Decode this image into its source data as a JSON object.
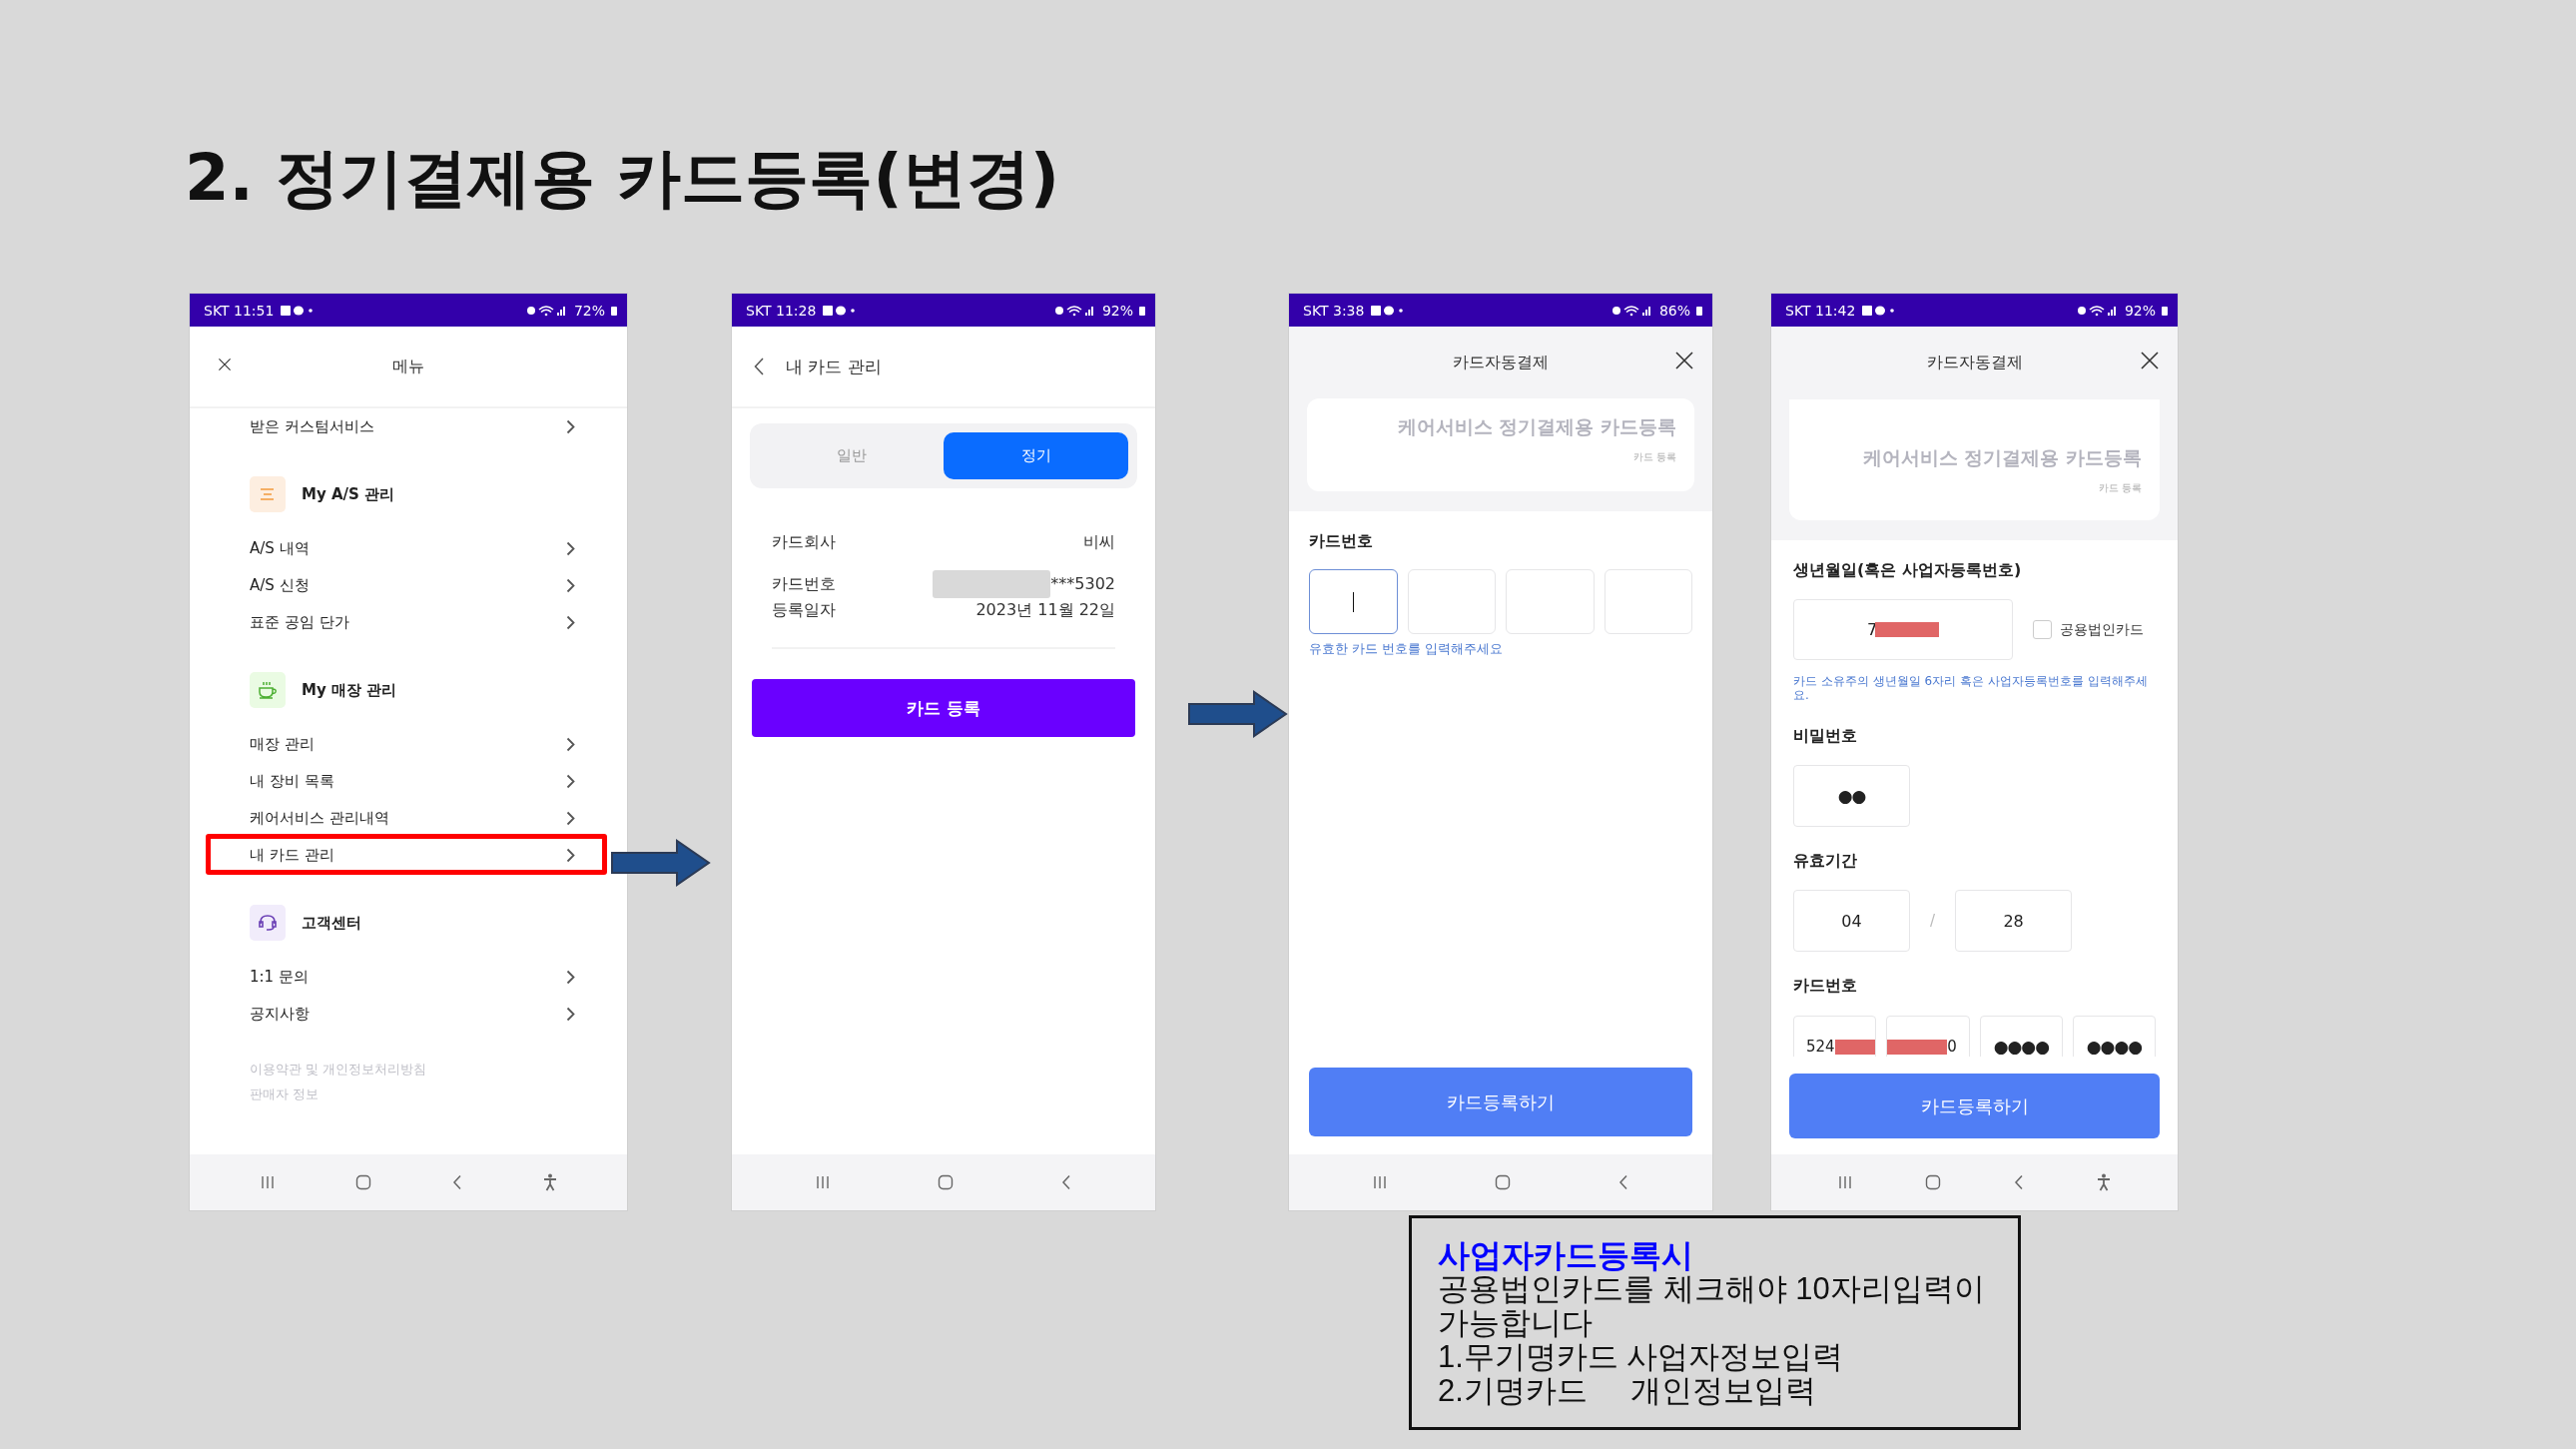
{
  "title": "2. 정기결제용 카드등록(변경)",
  "phones": [
    {
      "kind": "menu",
      "status": {
        "time": "SKT 11:51",
        "battery": "72%"
      },
      "header": {
        "title": "메뉴"
      },
      "items": [
        {
          "kind": "link",
          "label": "받은 커스텀서비스",
          "highlighted": false
        },
        {
          "kind": "section",
          "label": "My A/S 관리"
        },
        {
          "kind": "link",
          "label": "A/S 내역",
          "highlighted": false
        },
        {
          "kind": "link",
          "label": "A/S 신청",
          "highlighted": false
        },
        {
          "kind": "link",
          "label": "표준 공임 단가",
          "highlighted": false
        },
        {
          "kind": "section",
          "label": "My 매장 관리"
        },
        {
          "kind": "link",
          "label": "매장 관리",
          "highlighted": false
        },
        {
          "kind": "link",
          "label": "내 장비 목록",
          "highlighted": false
        },
        {
          "kind": "link",
          "label": "케어서비스 관리내역",
          "highlighted": false
        },
        {
          "kind": "link",
          "label": "내 카드 관리",
          "highlighted": true
        },
        {
          "kind": "section",
          "label": "고객센터"
        },
        {
          "kind": "link",
          "label": "1:1 문의",
          "highlighted": false
        },
        {
          "kind": "link",
          "label": "공지사항",
          "highlighted": false
        }
      ],
      "footer_links": [
        "이용약관 및 개인정보처리방침",
        "판매자 정보"
      ],
      "nav": {
        "accessibility_button": true
      }
    },
    {
      "kind": "card_list",
      "status": {
        "time": "SKT 11:28",
        "battery": "92%"
      },
      "header": {
        "title": "내 카드 관리"
      },
      "tabs": [
        {
          "label": "일반",
          "selected": false
        },
        {
          "label": "정기",
          "selected": true
        }
      ],
      "info": [
        {
          "label": "카드회사",
          "value": "비씨",
          "redacted": false
        },
        {
          "label": "카드번호",
          "value": "***5302",
          "redacted": true
        },
        {
          "label": "등록일자",
          "value": "2023년 11월 22일",
          "redacted": false
        }
      ],
      "button": "카드 등록",
      "nav": {
        "accessibility_button": false
      }
    },
    {
      "kind": "card_number",
      "status": {
        "time": "SKT 3:38",
        "battery": "86%"
      },
      "header": {
        "title": "카드자동결제"
      },
      "banner": {
        "title": "케어서비스 정기결제용 카드등록",
        "subtitle": "카드 등록"
      },
      "label": "카드번호",
      "boxes": [
        {
          "focused": true
        },
        {
          "focused": false
        },
        {
          "focused": false
        },
        {
          "focused": false
        }
      ],
      "hint": "유효한 카드 번호를 입력해주세요",
      "button": "카드등록하기",
      "nav": {
        "accessibility_button": false
      }
    },
    {
      "kind": "card_form",
      "status": {
        "time": "SKT 11:42",
        "battery": "92%"
      },
      "header": {
        "title": "카드자동결제"
      },
      "banner": {
        "title": "케어서비스 정기결제용 카드등록",
        "subtitle": "카드 등록"
      },
      "birth": {
        "label": "생년월일(혹은 사업자등록번호)",
        "value": "7",
        "redacted": true
      },
      "corporate_checkbox": {
        "label": "공용법인카드",
        "checked": false
      },
      "birth_hint": "카드 소유주의 생년월일 6자리 혹은 사업자등록번호를 입력해주세요.",
      "password": {
        "label": "비밀번호",
        "value": "●●"
      },
      "expiry": {
        "label": "유효기간",
        "month": "04",
        "separator": "/",
        "year": "28"
      },
      "card_number": {
        "label": "카드번호",
        "segments": [
          "524",
          "0",
          "●●●●",
          "●●●●"
        ],
        "redacted": true
      },
      "button": "카드등록하기",
      "nav": {
        "accessibility_button": true
      }
    }
  ],
  "note": {
    "title": "사업자카드등록시",
    "lines": [
      "공용법인카드를 체크해야 10자리입력이",
      "가능합니다",
      "1.무기명카드 사업자정보입력",
      "2.기명카드     개인정보입력"
    ]
  }
}
